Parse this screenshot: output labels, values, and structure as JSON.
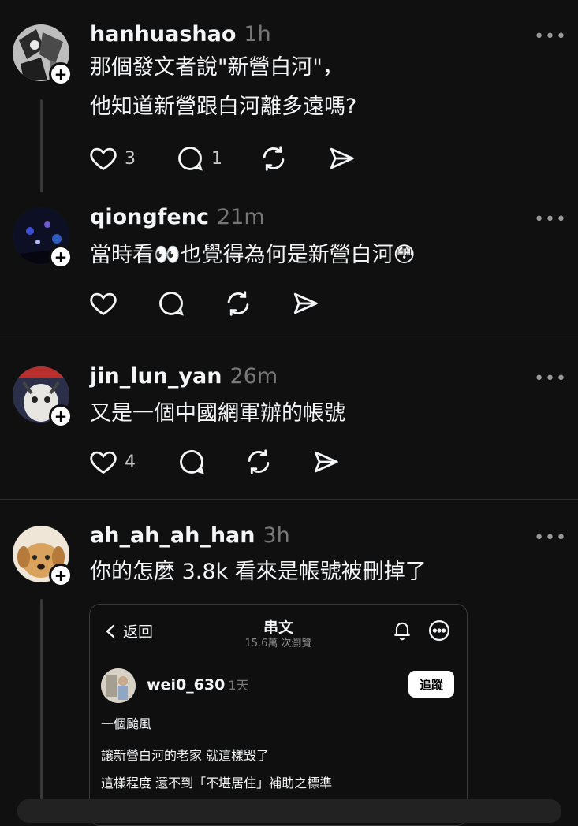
{
  "posts": [
    {
      "username": "hanhuashao",
      "time": "1h",
      "lines": [
        "那個發文者說\"新營白河\"，",
        "他知道新營跟白河離多遠嗎?"
      ],
      "likes": "3",
      "replies": "1"
    },
    {
      "username": "qiongfenc",
      "time": "21m",
      "lines": [
        "當時看👀也覺得為何是新營白河😳"
      ],
      "likes": "",
      "replies": ""
    },
    {
      "username": "jin_lun_yan",
      "time": "26m",
      "lines": [
        "又是一個中國網軍辦的帳號"
      ],
      "likes": "4",
      "replies": ""
    },
    {
      "username": "ah_ah_ah_han",
      "time": "3h",
      "lines": [
        "你的怎麼 3.8k 看來是帳號被刪掉了"
      ],
      "likes": "",
      "replies": ""
    }
  ],
  "more_glyph": "•••",
  "embed": {
    "back_label": "返回",
    "title": "串文",
    "views": "15.6萬 次瀏覽",
    "username": "wei0_630",
    "time": "1天",
    "follow_label": "追蹤",
    "lines": [
      "一個颱風",
      "讓新營白河的老家 就這樣毀了",
      "這樣程度 還不到「不堪居住」補助之標準"
    ]
  },
  "icons": {
    "like": "heart-icon",
    "reply": "comment-icon",
    "repost": "repost-icon",
    "share": "send-icon",
    "bell": "bell-icon",
    "more": "more-circle-icon"
  }
}
